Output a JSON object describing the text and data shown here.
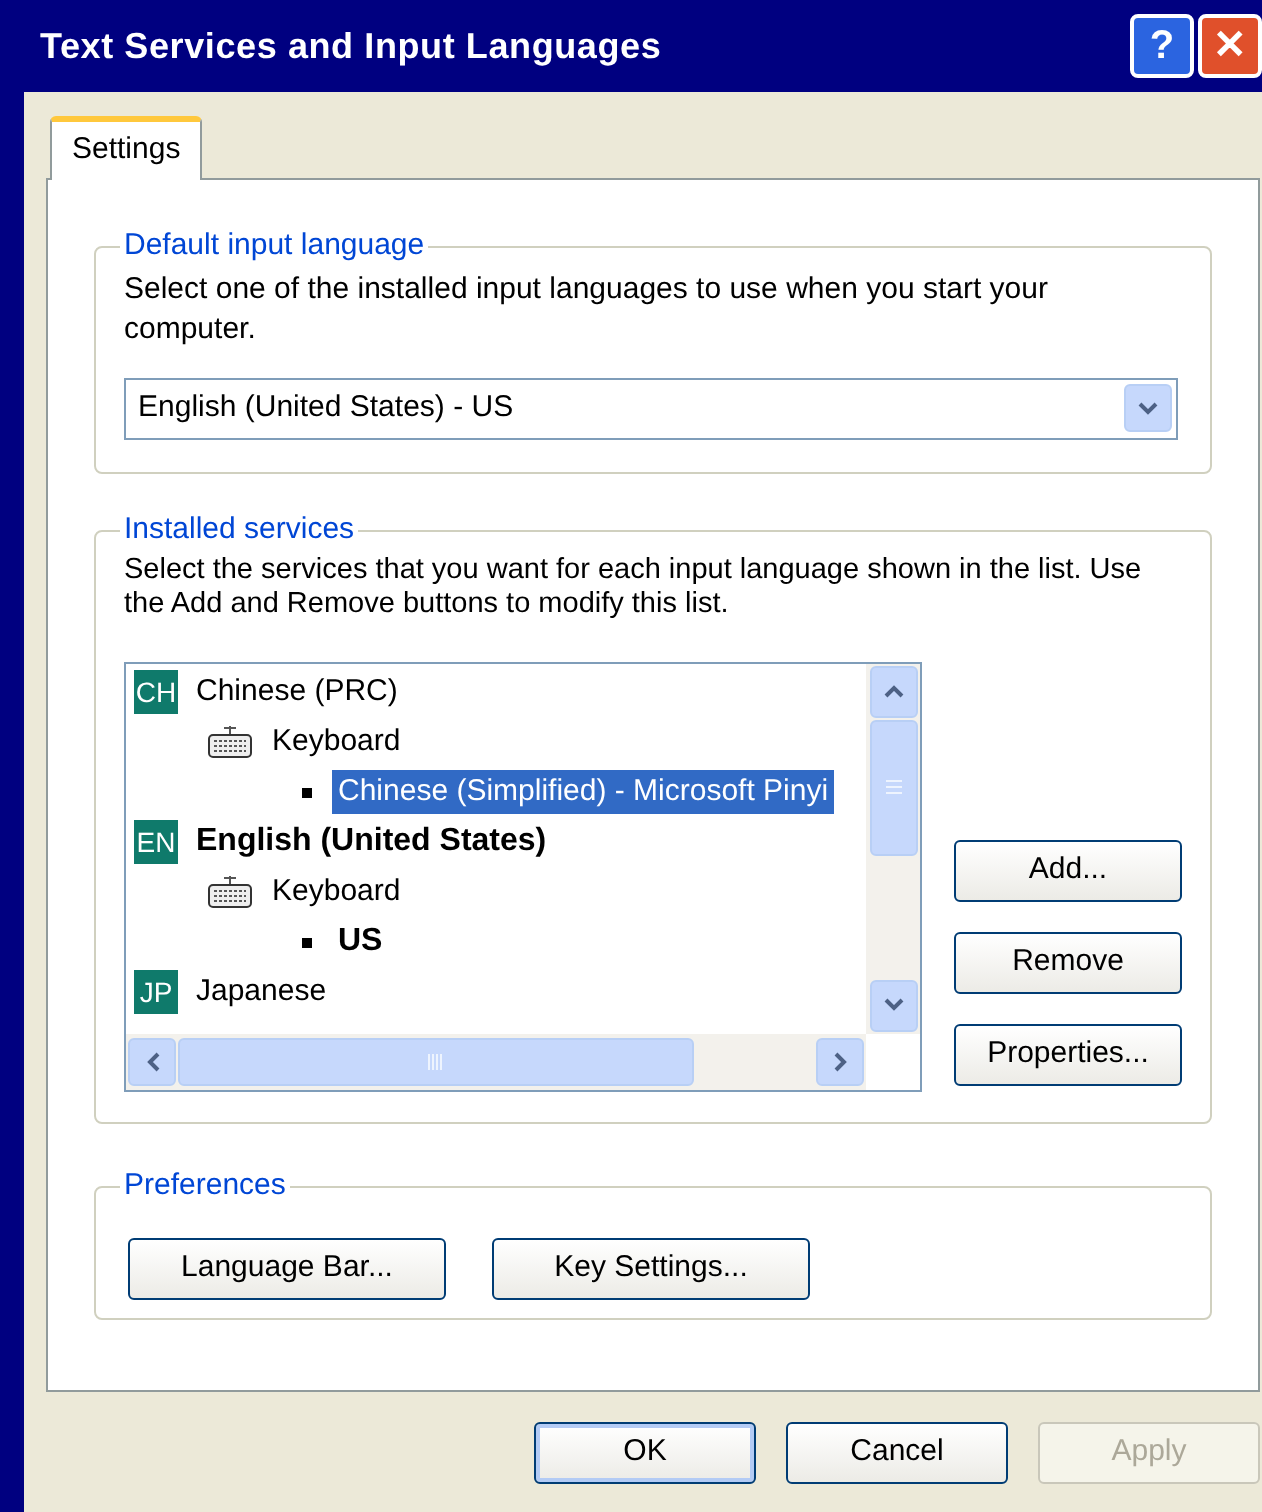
{
  "window": {
    "title": "Text Services and Input Languages",
    "buttons": [
      {
        "kind": "help",
        "label": "?"
      },
      {
        "kind": "close",
        "label": "✕"
      }
    ]
  },
  "tabs": [
    {
      "label": "Settings",
      "selected": true
    }
  ],
  "default_input_language": {
    "legend": "Default input language",
    "description": "Select one of the installed input languages to use when you start your computer.",
    "dropdown": {
      "value": "English (United States) - US"
    }
  },
  "installed_services": {
    "legend": "Installed services",
    "description": "Select the services that you want for each input language shown in the list. Use the Add and Remove buttons to modify this list.",
    "tree": [
      {
        "kind": "language",
        "badge": "CH",
        "label": "Chinese (PRC)",
        "default": false,
        "selected": false,
        "children": [
          {
            "kind": "category",
            "label": "Keyboard",
            "default": false,
            "selected": false,
            "children": [
              {
                "kind": "service",
                "label": "Chinese (Simplified) - Microsoft Pinyi",
                "default": false,
                "selected": true
              }
            ]
          }
        ]
      },
      {
        "kind": "language",
        "badge": "EN",
        "label": "English (United States)",
        "default": true,
        "selected": false,
        "children": [
          {
            "kind": "category",
            "label": "Keyboard",
            "default": false,
            "selected": false,
            "children": [
              {
                "kind": "service",
                "label": "US",
                "default": true,
                "selected": false
              }
            ]
          }
        ]
      },
      {
        "kind": "language",
        "badge": "JP",
        "label": "Japanese",
        "default": false,
        "selected": false
      }
    ],
    "buttons": [
      {
        "label": "Add...",
        "disabled": false
      },
      {
        "label": "Remove",
        "disabled": false
      },
      {
        "label": "Properties...",
        "disabled": false
      }
    ]
  },
  "preferences": {
    "legend": "Preferences",
    "buttons": [
      {
        "label": "Language Bar...",
        "disabled": false
      },
      {
        "label": "Key Settings...",
        "disabled": false
      }
    ]
  },
  "dialog_buttons": [
    {
      "label": "OK",
      "disabled": false,
      "default": true
    },
    {
      "label": "Cancel",
      "disabled": false,
      "default": false
    },
    {
      "label": "Apply",
      "disabled": true,
      "default": false
    }
  ]
}
